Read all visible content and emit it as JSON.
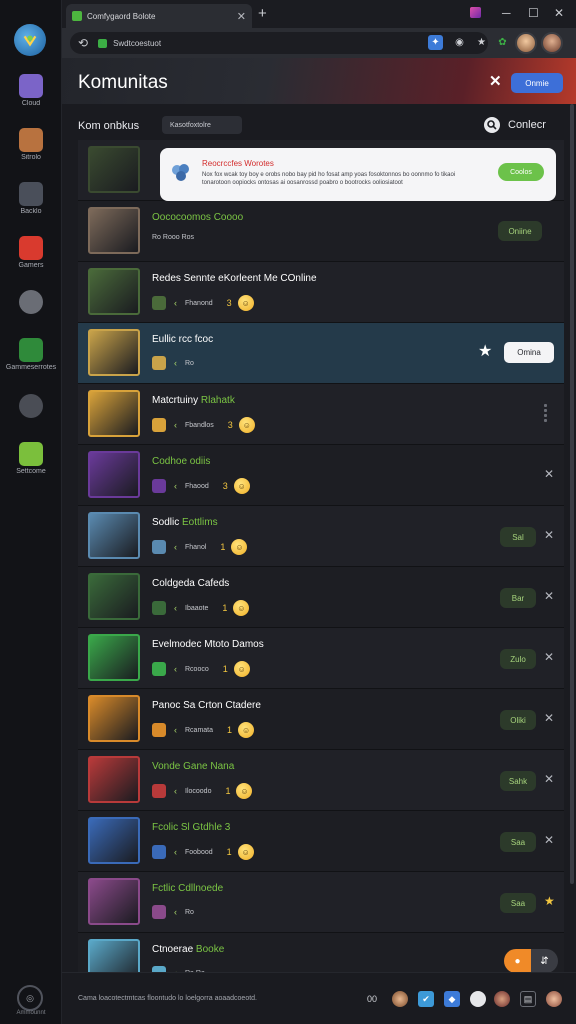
{
  "rail": {
    "items": [
      {
        "label": "Cloud",
        "color": "#7b64c8"
      },
      {
        "label": "Sitrolo",
        "color": "#b8723f"
      },
      {
        "label": "Backlo",
        "color": "#4a4f5a"
      },
      {
        "label": "Gamers",
        "color": "#d93a2e"
      },
      {
        "label": "",
        "color": "#6a6d75"
      },
      {
        "label": "Gammeserrotes",
        "color": "#2f8a3a"
      },
      {
        "label": "",
        "color": "#4a4d55"
      },
      {
        "label": "Settcome",
        "color": "#7bbf3c"
      }
    ],
    "bottom_label": "Ammounnt"
  },
  "browser": {
    "tab_title": "Comfygaord Bolote",
    "url": "Swdtcoestuot",
    "ext_colors": [
      "#3d7bd8",
      "#cfd1d6",
      "#cfd1d6",
      "#3cae45",
      "#d9a146"
    ]
  },
  "header": {
    "title": "Komunitas",
    "button": "Onmie"
  },
  "content": {
    "section_title": "Kom onbkus",
    "filter_label": "Kasotfoxtolre",
    "search_label": "Conlecr"
  },
  "notification": {
    "title": "Reocrccfes Worotes",
    "body": "Nox fox wcak toy boy e orobs nobo bay pid ho fosat amp yoas fosoktonnos bo oonnmo fo tikaoi tonarotoon oopiocks ontosas ai oosanrossd poabro o bootrocks ooliosiatoot",
    "button": "Coolos"
  },
  "rows": [
    {
      "title": "",
      "title_hl": "",
      "sub": "",
      "count": "",
      "action": "notification",
      "color": "#3a4a30"
    },
    {
      "title": "",
      "title_hl": "Oococoomos Coooo",
      "sub": "Ro Rooo Ros",
      "count": "",
      "action": "Oniine",
      "color": "#7d6a5a"
    },
    {
      "title": "Redes Sennte eKorleent Me COnline",
      "title_hl": "",
      "sub": "Fhanond",
      "count": "3",
      "action": "",
      "color": "#4a6a3a"
    },
    {
      "title": "Eullic rcc fcoc",
      "title_hl": "",
      "sub": "Ro",
      "count": "",
      "action": "Omina",
      "color": "#c9a34a"
    },
    {
      "title": "Matcrtuiny ",
      "title_hl": "Rlahatk",
      "sub": "Fbandlos",
      "count": "3",
      "action": "dots",
      "color": "#d8a23a"
    },
    {
      "title": "",
      "title_hl": "Codhoe odiis",
      "sub": "Fhaood",
      "count": "3",
      "action": "x",
      "color": "#6a3a9a"
    },
    {
      "title": "Sodlic ",
      "title_hl": "Eottlims",
      "sub": "Fhanol",
      "count": "1",
      "action": "Sal",
      "color": "#5a8ab0"
    },
    {
      "title": "Coldgeda Cafeds",
      "title_hl": "",
      "sub": "Ibaaote",
      "count": "1",
      "action": "Bar",
      "color": "#3a6a3a"
    },
    {
      "title": "Evelmodec Mtoto Damos",
      "title_hl": "",
      "sub": "Rcooco",
      "count": "1",
      "action": "Zulo",
      "color": "#3aa84a"
    },
    {
      "title": "Panoc Sa Crton Ctadere",
      "title_hl": "",
      "sub": "Rcamata",
      "count": "1",
      "action": "Oliki",
      "color": "#d88a2a"
    },
    {
      "title": "",
      "title_hl": "Vonde Gane Nana",
      "sub": "Ilocoodo",
      "count": "1",
      "action": "Sahk",
      "color": "#b83a3a"
    },
    {
      "title": "",
      "title_hl": "Fcolic Sl Gtdhle 3",
      "sub": "Foobood",
      "count": "1",
      "action": "Saa",
      "color": "#3a6ab8"
    },
    {
      "title": "",
      "title_hl": "Fctlic Cdllnoede",
      "sub": "Ro",
      "count": "",
      "action": "Saa",
      "color": "#8a4a8a"
    },
    {
      "title": "Ctnoerae ",
      "title_hl": "Booke",
      "sub": "Ra Ra",
      "count": "",
      "action": "orange",
      "color": "#5aa8c8"
    }
  ],
  "footer": {
    "text": "Cama loacotectmtcas floontudo lo loelgorra aoaadcoeotd.",
    "count": "00"
  }
}
